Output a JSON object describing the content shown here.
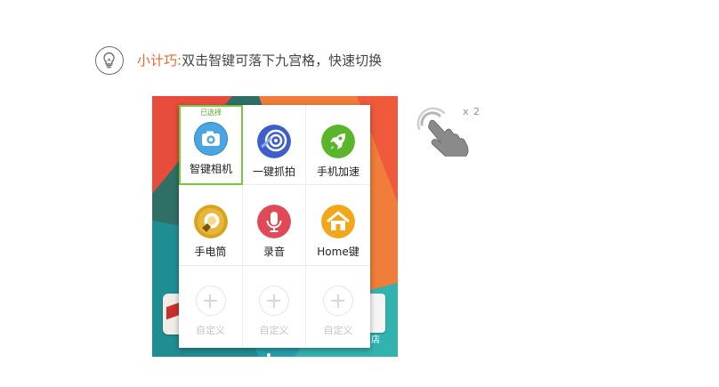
{
  "tip": {
    "icon": "lightbulb-icon",
    "label": "小计巧:",
    "text": "双击智键可落下九宫格，快速切换"
  },
  "grid": {
    "selected_tag": "已选择",
    "items": [
      {
        "label": "智键相机",
        "icon": "camera-icon",
        "color": "#4aa6e0",
        "selected": true
      },
      {
        "label": "一键抓拍",
        "icon": "snapshot-icon",
        "color": "#3e5fc9",
        "selected": false
      },
      {
        "label": "手机加速",
        "icon": "rocket-icon",
        "color": "#5ab52b",
        "selected": false
      },
      {
        "label": "手电筒",
        "icon": "flashlight-icon",
        "color": "#d9a31d",
        "selected": false
      },
      {
        "label": "录音",
        "icon": "microphone-icon",
        "color": "#e04a58",
        "selected": false
      },
      {
        "label": "Home键",
        "icon": "home-icon",
        "color": "#f2a71a",
        "selected": false
      },
      {
        "label": "自定义",
        "icon": "add-icon",
        "color": "#d8d8d8",
        "selected": false
      },
      {
        "label": "自定义",
        "icon": "add-icon",
        "color": "#d8d8d8",
        "selected": false
      },
      {
        "label": "自定义",
        "icon": "add-icon",
        "color": "#d8d8d8",
        "selected": false
      }
    ]
  },
  "wallpaper": {
    "store_label": "店"
  },
  "gesture": {
    "icon": "double-tap-hand-icon",
    "count": "x 2"
  }
}
